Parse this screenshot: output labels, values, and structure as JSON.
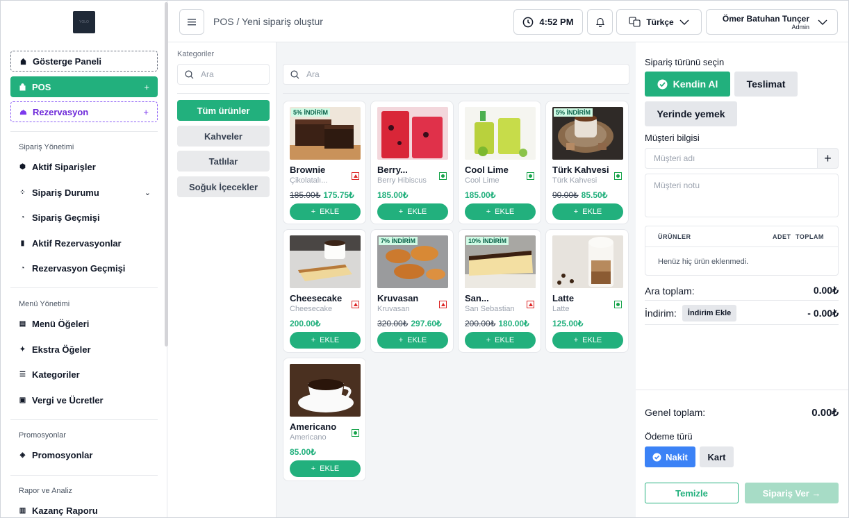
{
  "sidebar": {
    "logo_text": "YOLO",
    "dashboard_label": "Gösterge Paneli",
    "pos_label": "POS",
    "reservation_label": "Rezervasyon",
    "plus_glyph": "+",
    "sections": [
      {
        "title": "Sipariş Yönetimi",
        "items": [
          "Aktif Siparişler",
          "Sipariş Durumu",
          "Sipariş Geçmişi",
          "Aktif Rezervasyonlar",
          "Rezervasyon Geçmişi"
        ]
      },
      {
        "title": "Menü Yönetimi",
        "items": [
          "Menü Öğeleri",
          "Ekstra Öğeler",
          "Kategoriler",
          "Vergi ve Ücretler"
        ]
      },
      {
        "title": "Promosyonlar",
        "items": [
          "Promosyonlar"
        ]
      },
      {
        "title": "Rapor ve Analiz",
        "items": [
          "Kazanç Raporu"
        ]
      }
    ]
  },
  "header": {
    "breadcrumb": "POS / Yeni sipariş oluştur",
    "time": "4:52 PM",
    "language": "Türkçe",
    "user_name": "Ömer Batuhan Tunçer",
    "user_role": "Admin"
  },
  "categories": {
    "title": "Kategoriler",
    "search_placeholder": "Ara",
    "items": [
      "Tüm ürünler",
      "Kahveler",
      "Tatlılar",
      "Soğuk İçecekler"
    ],
    "active": "Tüm ürünler"
  },
  "products": {
    "search_placeholder": "Ara",
    "add_label": "EKLE",
    "items": [
      {
        "name": "Brownie",
        "sub": "Çikolatalı...",
        "old_price": "185.00₺",
        "price": "175.75₺",
        "badge": "5% İNDİRİM",
        "veg": false
      },
      {
        "name": "Berry...",
        "sub": "Berry Hibiscus",
        "old_price": "",
        "price": "185.00₺",
        "badge": "",
        "veg": true
      },
      {
        "name": "Cool Lime",
        "sub": "Cool Lime",
        "old_price": "",
        "price": "185.00₺",
        "badge": "",
        "veg": true
      },
      {
        "name": "Türk Kahvesi",
        "sub": "Türk Kahvesi",
        "old_price": "90.00₺",
        "price": "85.50₺",
        "badge": "5% İNDİRİM",
        "veg": true
      },
      {
        "name": "Cheesecake",
        "sub": "Cheesecake",
        "old_price": "",
        "price": "200.00₺",
        "badge": "",
        "veg": false
      },
      {
        "name": "Kruvasan",
        "sub": "Kruvasan",
        "old_price": "320.00₺",
        "price": "297.60₺",
        "badge": "7% İNDİRİM",
        "veg": false
      },
      {
        "name": "San...",
        "sub": "San Sebastian",
        "old_price": "200.00₺",
        "price": "180.00₺",
        "badge": "10% İNDİRİM",
        "veg": false
      },
      {
        "name": "Latte",
        "sub": "Latte",
        "old_price": "",
        "price": "125.00₺",
        "badge": "",
        "veg": true
      },
      {
        "name": "Americano",
        "sub": "Americano",
        "old_price": "",
        "price": "85.00₺",
        "badge": "",
        "veg": true
      }
    ]
  },
  "order": {
    "type_title": "Sipariş türünü seçin",
    "types": [
      "Kendin Al",
      "Teslimat",
      "Yerinde yemek"
    ],
    "active_type": "Kendin Al",
    "customer_title": "Müşteri bilgisi",
    "customer_name_placeholder": "Müşteri adı",
    "customer_note_placeholder": "Müşteri notu",
    "col_products": "ÜRÜNLER",
    "col_qty": "ADET",
    "col_total": "TOPLAM",
    "empty_text": "Henüz hiç ürün eklenmedi.",
    "subtotal_label": "Ara toplam:",
    "subtotal_value": "0.00₺",
    "discount_label": "İndirim:",
    "discount_button": "İndirim Ekle",
    "discount_value": "- 0.00₺",
    "grand_total_label": "Genel toplam:",
    "grand_total_value": "0.00₺",
    "payment_title": "Ödeme türü",
    "payment_types": [
      "Nakit",
      "Kart"
    ],
    "active_payment": "Nakit",
    "clear_label": "Temizle",
    "submit_label": "Sipariş Ver →"
  },
  "colors": {
    "accent": "#22b07d",
    "purple": "#6d28d9",
    "blue": "#3b82f6"
  }
}
